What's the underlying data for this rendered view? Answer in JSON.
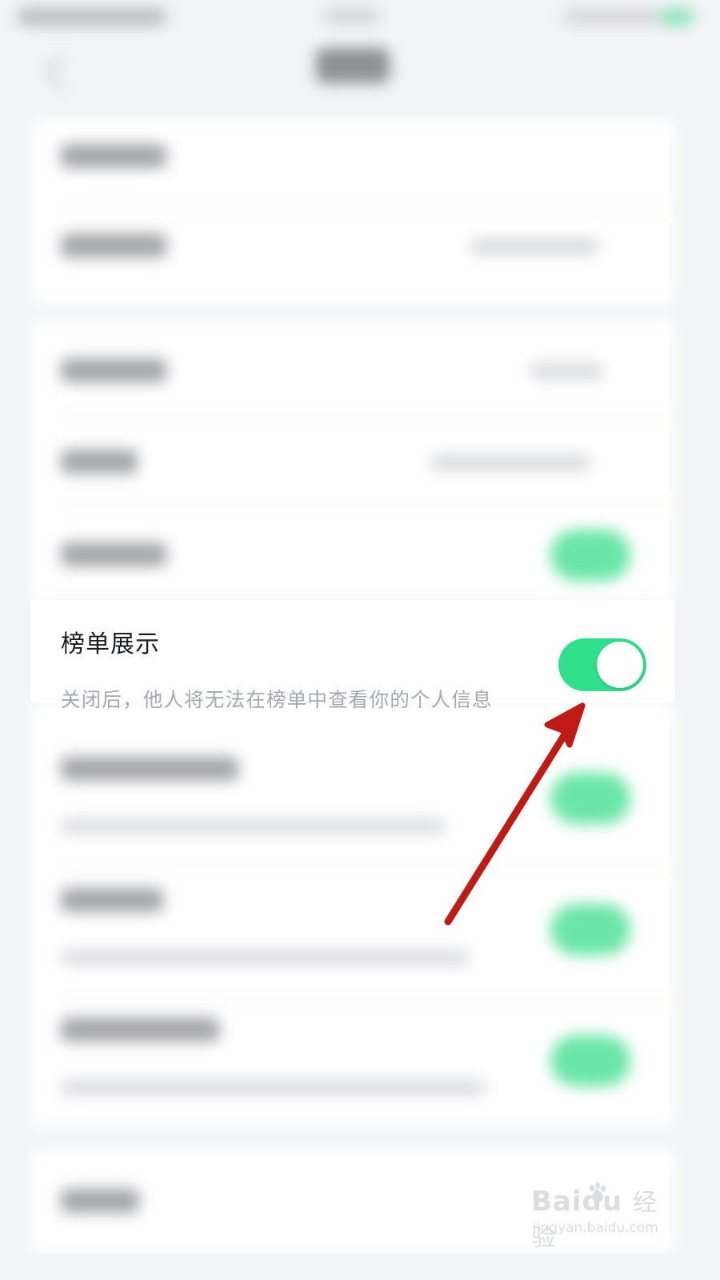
{
  "focus_item": {
    "title": "榜单展示",
    "description": "关闭后，他人将无法在榜单中查看你的个人信息",
    "toggle_on": true
  },
  "watermark": {
    "logo_latin": "Bai",
    "logo_suffix": "du",
    "logo_cn": "经验",
    "url": "jingyan.baidu.com"
  },
  "colors": {
    "toggle_on": "#2fe08a",
    "arrow": "#c01a14",
    "background": "#f3f4f7"
  },
  "icons": [
    "back-chevron-icon",
    "battery-icon",
    "annotation-arrow-icon",
    "baidu-paw-icon"
  ]
}
